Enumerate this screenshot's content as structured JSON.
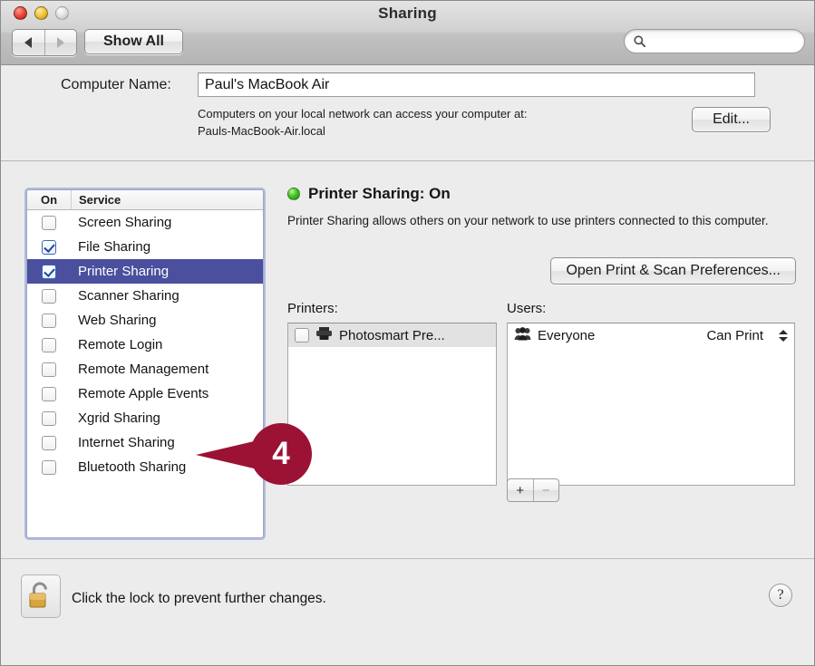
{
  "window": {
    "title": "Sharing",
    "traffic_lights": [
      "close",
      "minimize",
      "zoom"
    ]
  },
  "toolbar": {
    "back_label": "Back",
    "forward_label": "Forward",
    "show_all_label": "Show All",
    "search_value": "",
    "search_placeholder": ""
  },
  "computer_name": {
    "label": "Computer Name:",
    "value": "Paul's MacBook Air",
    "note_line1": "Computers on your local network can access your computer at:",
    "note_line2": "Pauls-MacBook-Air.local",
    "edit_label": "Edit..."
  },
  "services": {
    "header_on": "On",
    "header_service": "Service",
    "items": [
      {
        "label": "Screen Sharing",
        "checked": false,
        "selected": false
      },
      {
        "label": "File Sharing",
        "checked": true,
        "selected": false
      },
      {
        "label": "Printer Sharing",
        "checked": true,
        "selected": true
      },
      {
        "label": "Scanner Sharing",
        "checked": false,
        "selected": false
      },
      {
        "label": "Web Sharing",
        "checked": false,
        "selected": false
      },
      {
        "label": "Remote Login",
        "checked": false,
        "selected": false
      },
      {
        "label": "Remote Management",
        "checked": false,
        "selected": false
      },
      {
        "label": "Remote Apple Events",
        "checked": false,
        "selected": false
      },
      {
        "label": "Xgrid Sharing",
        "checked": false,
        "selected": false
      },
      {
        "label": "Internet Sharing",
        "checked": false,
        "selected": false
      },
      {
        "label": "Bluetooth Sharing",
        "checked": false,
        "selected": false
      }
    ]
  },
  "detail": {
    "status_title": "Printer Sharing: On",
    "status_color": "#3cbd24",
    "description": "Printer Sharing allows others on your network to use printers connected to this computer.",
    "open_prefs_label": "Open Print & Scan Preferences...",
    "printers_label": "Printers:",
    "printers": [
      {
        "name": "Photosmart Pre...",
        "checked": false
      }
    ],
    "users_label": "Users:",
    "users": [
      {
        "name": "Everyone",
        "permission": "Can Print"
      }
    ],
    "add_label": "+",
    "remove_label": "−"
  },
  "footer": {
    "lock_text": "Click the lock to prevent further changes.",
    "help_label": "?"
  },
  "callout": {
    "number": "4",
    "color": "#9b1234"
  }
}
